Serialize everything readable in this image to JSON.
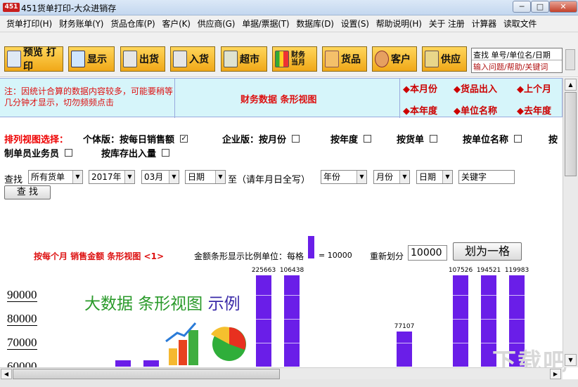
{
  "window": {
    "title": "451货单打印-大众进销存",
    "app_badge": "451",
    "minimize": "─",
    "maximize": "□",
    "close": "✕"
  },
  "menu": [
    "货单打印(H)",
    "财务账单(Y)",
    "货品仓库(P)",
    "客户(K)",
    "供应商(G)",
    "单据/票据(T)",
    "数据库(D)",
    "设置(S)",
    "帮助说明(H)",
    "关于 注册",
    "计算器",
    "读取文件"
  ],
  "toolbar": {
    "preview_print": "预览 打印",
    "display": "显示",
    "ship": "出货",
    "receive": "入货",
    "supermarket": "超市",
    "finance_l1": "财务",
    "finance_l2": "当月",
    "goods": "货品",
    "customer": "客户",
    "supplier": "供应",
    "search_line1": "查找 单号/单位名/日期",
    "search_line2": "输入问题/帮助/关键词"
  },
  "info": {
    "note": "注：因统计合算的数据内容较多，可能要稍等几分钟才显示，切勿频频点击",
    "title": "财务数据  条形视图",
    "links": [
      "◆本月份",
      "◆货品出入",
      "◆上个月",
      "◆本年度",
      "◆单位名称",
      "◆去年度"
    ]
  },
  "options": {
    "label": "排列视图选择：",
    "personal": "个体版：按每日销售额",
    "enterprise": "企业版：按月份",
    "by_year": "按年度",
    "by_order": "按货单",
    "by_unit": "按单位名称",
    "by_cut": "按",
    "by_staff": "制单员业务员",
    "by_stock": "按库存出入量",
    "checked_mark": "✓"
  },
  "filter": {
    "label": "查找",
    "doc_type": "所有货单",
    "year": "2017年",
    "month": "03月",
    "date": "日期",
    "to": "至（请年月日全写）",
    "year2": "年份",
    "month2": "月份",
    "date2": "日期",
    "keyword": "关键字",
    "search_button": "查 找",
    "arrow": "▼"
  },
  "chart_header": {
    "title": "按每个月 销售金额 条形视图 <1>",
    "scale_text": "金额条形显示比例单位：每格",
    "scale_eq": "= 10000",
    "regroup_label": "重新划分",
    "regroup_value": "10000",
    "regroup_button": "划为一格"
  },
  "caption": {
    "part1": "大数据 条形视图",
    "part2": "示例"
  },
  "colors": {
    "bar": "#6a1ee8",
    "accent_red": "#d11111",
    "info_bg": "#d6f5fa",
    "caption_green": "#2a9a2a",
    "caption_blue": "#3a2aa8"
  },
  "chart_data": {
    "type": "bar",
    "ylabels": [
      "90000",
      "80000",
      "70000",
      "60000"
    ],
    "y_ticks": [
      90000,
      80000,
      70000,
      60000
    ],
    "unit_per_segment": 10000,
    "bars": [
      {
        "value": 65000,
        "label": ""
      },
      {
        "value": 65000,
        "label": ""
      },
      {
        "value": 225663,
        "label": "225663"
      },
      {
        "value": 106438,
        "label": "106438"
      },
      {
        "value": 77107,
        "label": "77107"
      },
      {
        "value": 107526,
        "label": "107526"
      },
      {
        "value": 194521,
        "label": "194521"
      },
      {
        "value": 119983,
        "label": "119983"
      }
    ]
  },
  "scroll": {
    "up": "▲",
    "down": "▼",
    "left": "◀",
    "right": "▶"
  },
  "watermark": "下载吧"
}
